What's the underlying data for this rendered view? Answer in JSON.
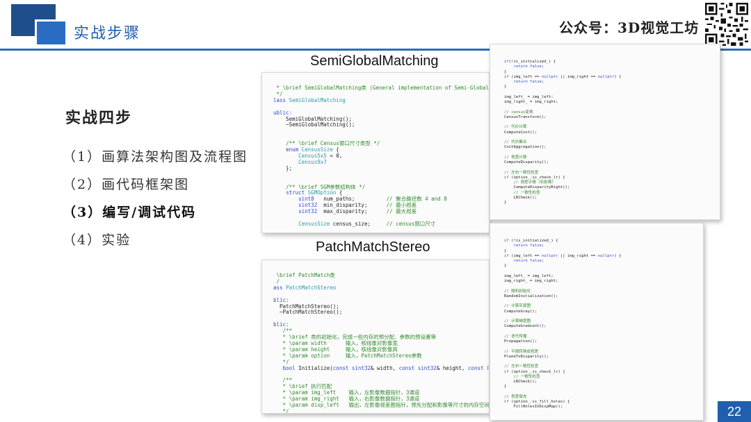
{
  "header": {
    "title": "实战步骤",
    "wechat": "公众号：3D视觉工坊",
    "accent_color": "#1f5fae"
  },
  "main": {
    "section_heading": "实战四步",
    "steps": [
      "（1）画算法架构图及流程图",
      "（2）画代码框架图",
      "（3）编写/调试代码",
      "（4）实验"
    ]
  },
  "code_sections": {
    "sgm_label": "SemiGlobalMatching",
    "pms_label": "PatchMatchStereo"
  },
  "footer": {
    "page_number": "22"
  }
}
